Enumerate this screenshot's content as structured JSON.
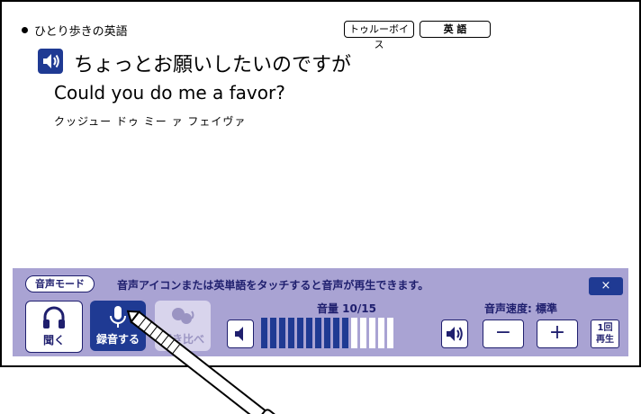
{
  "header": {
    "section_title": "ひとり歩きの英語",
    "true_voice_label": "トゥルーボイス",
    "english_label": "英 語"
  },
  "phrase": {
    "japanese": "ちょっとお願いしたいのですが",
    "english": "Could you do me a favor?",
    "pronunciation": "クッジュー ドゥ ミー ァ フェイヴァ"
  },
  "voice_panel": {
    "mode_label": "音声モード",
    "hint": "音声アイコンまたは英単語をタッチすると音声が再生できます。",
    "close_label": "×",
    "listen_label": "聞く",
    "record_label": "録音する",
    "compare_label": "聞き比べ",
    "volume_label": "音量 10/15",
    "volume_level": 10,
    "volume_max": 15,
    "speed_label": "音声速度: 標準",
    "speed_down_label": "−",
    "speed_up_label": "+",
    "play_once_label_1": "1回",
    "play_once_label_2": "再生"
  },
  "colors": {
    "panel_bg": "#a9a3d3",
    "accent": "#1f3a93",
    "bar_off": "#ffffff"
  }
}
